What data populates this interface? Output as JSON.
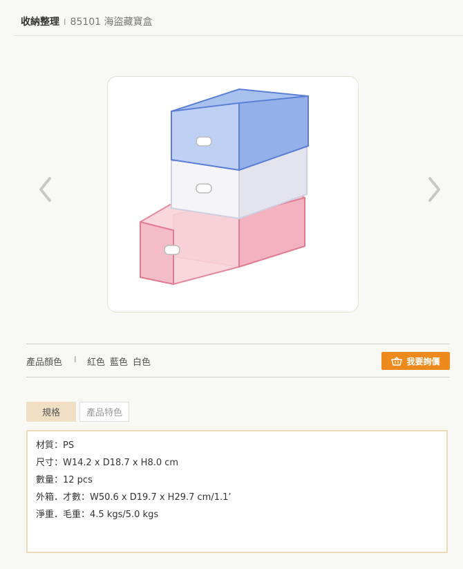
{
  "breadcrumb": {
    "category": "收納整理",
    "separator": "I",
    "product": "85101 海盜藏寶盒"
  },
  "gallery": {
    "prev_icon": "chevron-left-icon",
    "next_icon": "chevron-right-icon",
    "image": "product-photo-stacked-drawer-boxes-blue-white-pink"
  },
  "colors": {
    "label": "產品顏色",
    "separator": "I",
    "options": [
      "紅色",
      "藍色",
      "白色"
    ]
  },
  "quote_button": {
    "label": "我要詢價",
    "icon": "basket-icon",
    "color": "#ee8a1b"
  },
  "tabs": [
    {
      "label": "規格",
      "active": true
    },
    {
      "label": "產品特色",
      "active": false
    }
  ],
  "specs": [
    "材質：PS",
    "尺寸：W14.2 x D18.7 x H8.0 cm",
    "數量：12 pcs",
    "外箱．才數：W50.6 x D19.7 x H29.7 cm/1.1’",
    "淨重．毛重：4.5 kgs/5.0 kgs"
  ],
  "theme": {
    "background": "#f8f8f4",
    "accent": "#ee8a1b",
    "tab_active": "#f1dfc5",
    "spec_border": "#eed9b9"
  }
}
